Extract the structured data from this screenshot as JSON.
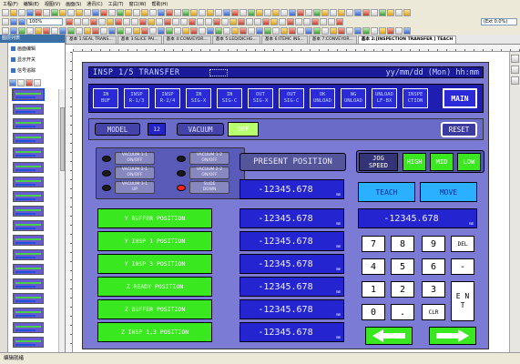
{
  "menu": [
    "工程(F)",
    "编辑(E)",
    "视图(V)",
    "画面(S)",
    "通讯(C)",
    "工具(T)",
    "窗口(W)",
    "帮助(H)"
  ],
  "toolbar": {
    "zoom_value": "100%",
    "right_combo": "(Ext 0.0%)"
  },
  "tabs": [
    "基本 1:SEAL TRANS...",
    "基本 3:SLICE PAI...",
    "基本 4:CONVEYOR...",
    "基本 5:LED/DICHG...",
    "基本 6:ITEMC INS...",
    "基本 7:CONVEYOR...",
    "基本 2:[INSPECTION TRANSFER ] TEACH"
  ],
  "left_panel": {
    "title": "图层列表",
    "items": [
      "画面编辑",
      "显示开关",
      "信号追踪"
    ]
  },
  "hmi": {
    "title": "INSP 1/5 TRANSFER",
    "datetime": "yy/mm/dd  (Mon)  hh:mm",
    "nav": [
      [
        "IN",
        "BUF"
      ],
      [
        "INSP",
        "R-1/3"
      ],
      [
        "INSP",
        "R-2/4"
      ],
      [
        "IN",
        "SIG-X"
      ],
      [
        "IN",
        "SIG-C"
      ],
      [
        "OUT",
        "SIG-X"
      ],
      [
        "OUT",
        "SIG-C"
      ],
      [
        "OK",
        "UNLOAD"
      ],
      [
        "NG",
        "UNLOAD"
      ],
      [
        "UNLOAD",
        "LF-BX"
      ],
      [
        "INSPE",
        "CTION"
      ]
    ],
    "main_label": "MAIN",
    "model_label": "MODEL",
    "model_value": "12",
    "vacuum_label": "VACUUM",
    "vacuum_state": "OFF",
    "reset_label": "RESET",
    "vacuum_items": [
      [
        "VACUUM 1-1",
        "ON/OFF"
      ],
      [
        "VACUUM 1-2",
        "ON/OFF"
      ],
      [
        "VACUUM 2-1",
        "ON/OFF"
      ],
      [
        "VACUUM 2-2",
        "ON/OFF"
      ],
      [
        "VACUUM 3-1",
        "UP"
      ],
      [
        "SLIDE",
        "DOWN"
      ]
    ],
    "present_label": "PRESENT POSITION",
    "jog_label_1": "JOG",
    "jog_label_2": "SPEED",
    "speed": [
      "HIGH",
      "MID",
      "LOW"
    ],
    "teach_label": "TEACH",
    "move_label": "MOVE",
    "positions": [
      "Y BUFFER POSITION",
      "Y INSP 1 POSITION",
      "Y INSP 3 POSITION",
      "Z READY POSITION",
      "Z BUFFER POSITION",
      "Z INSP 1,3 POSITION"
    ],
    "present_value": "-12345.678",
    "position_values": [
      "-12345.678",
      "-12345.678",
      "-12345.678",
      "-12345.678",
      "-12345.678",
      "-12345.678"
    ],
    "unit": "mm",
    "entry_value": "-12345.678",
    "keys": [
      "7",
      "8",
      "9",
      "DEL",
      "4",
      "5",
      "6",
      "-",
      "1",
      "2",
      "3",
      "0",
      ".",
      "CLR"
    ],
    "enter_label": "E N T"
  },
  "status": "编辑就绪"
}
